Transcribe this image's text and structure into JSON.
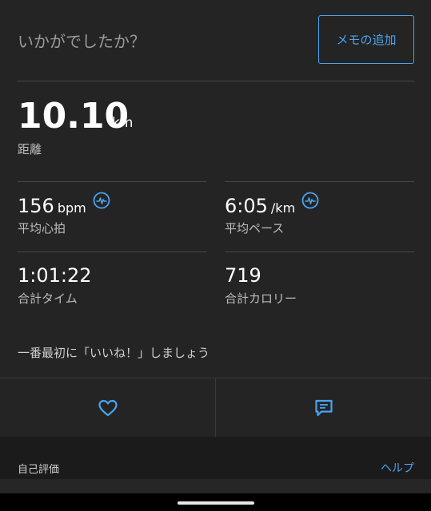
{
  "header": {
    "prompt": "いかがでしたか？",
    "memo_button": "メモの追加"
  },
  "distance": {
    "value": "10.10",
    "unit": "km",
    "label": "距離"
  },
  "stats": {
    "heart_rate": {
      "value": "156",
      "unit": "bpm",
      "label": "平均心拍",
      "icon": "heart-rate-icon"
    },
    "pace": {
      "value": "6:05",
      "unit": "/km",
      "label": "平均ペース",
      "icon": "heart-rate-icon"
    },
    "time": {
      "value": "1:01:22",
      "label": "合計タイム"
    },
    "calories": {
      "value": "719",
      "label": "合計カロリー"
    }
  },
  "social": {
    "like_prompt": "一番最初に「いいね！」しましょう",
    "like_icon": "heart-icon",
    "comment_icon": "comment-icon"
  },
  "self_evaluation": {
    "title": "自己評価",
    "help": "ヘルプ"
  },
  "colors": {
    "accent": "#4aa3ef",
    "background": "#242424"
  }
}
